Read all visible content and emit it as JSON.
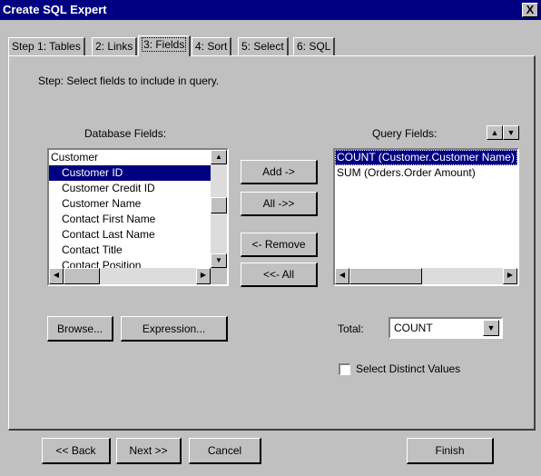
{
  "window": {
    "title": "Create SQL Expert",
    "close_label": "X"
  },
  "tabs": [
    {
      "label": "Step 1: Tables",
      "active": false
    },
    {
      "label": "2: Links",
      "active": false
    },
    {
      "label": "3: Fields",
      "active": true
    },
    {
      "label": "4: Sort",
      "active": false
    },
    {
      "label": "5: Select",
      "active": false
    },
    {
      "label": "6: SQL",
      "active": false
    }
  ],
  "step_text": "Step:  Select fields to include in query.",
  "database_fields": {
    "label": "Database Fields:",
    "items": [
      "Customer",
      "Customer ID",
      "Customer Credit ID",
      "Customer Name",
      "Contact First Name",
      "Contact Last Name",
      "Contact Title",
      "Contact Position"
    ],
    "selected_index": 1
  },
  "query_fields": {
    "label": "Query Fields:",
    "items": [
      "COUNT (Customer.Customer Name)",
      "SUM (Orders.Order Amount)"
    ],
    "selected_index": 0
  },
  "buttons": {
    "add": "Add ->",
    "all": "All ->>",
    "remove": "<- Remove",
    "remove_all": "<<- All",
    "browse": "Browse...",
    "expression": "Expression...",
    "back": "<< Back",
    "next": "Next >>",
    "cancel": "Cancel",
    "finish": "Finish"
  },
  "total": {
    "label": "Total:",
    "value": "COUNT"
  },
  "distinct": {
    "label": "Select Distinct Values",
    "checked": false
  },
  "colors": {
    "face": "#c0c0c0",
    "title": "#000080",
    "selection": "#000080"
  },
  "icons": [
    "up-arrow-icon",
    "down-arrow-icon",
    "scroll-left-icon",
    "scroll-right-icon",
    "scroll-up-icon",
    "scroll-down-icon",
    "dropdown-arrow-icon"
  ]
}
